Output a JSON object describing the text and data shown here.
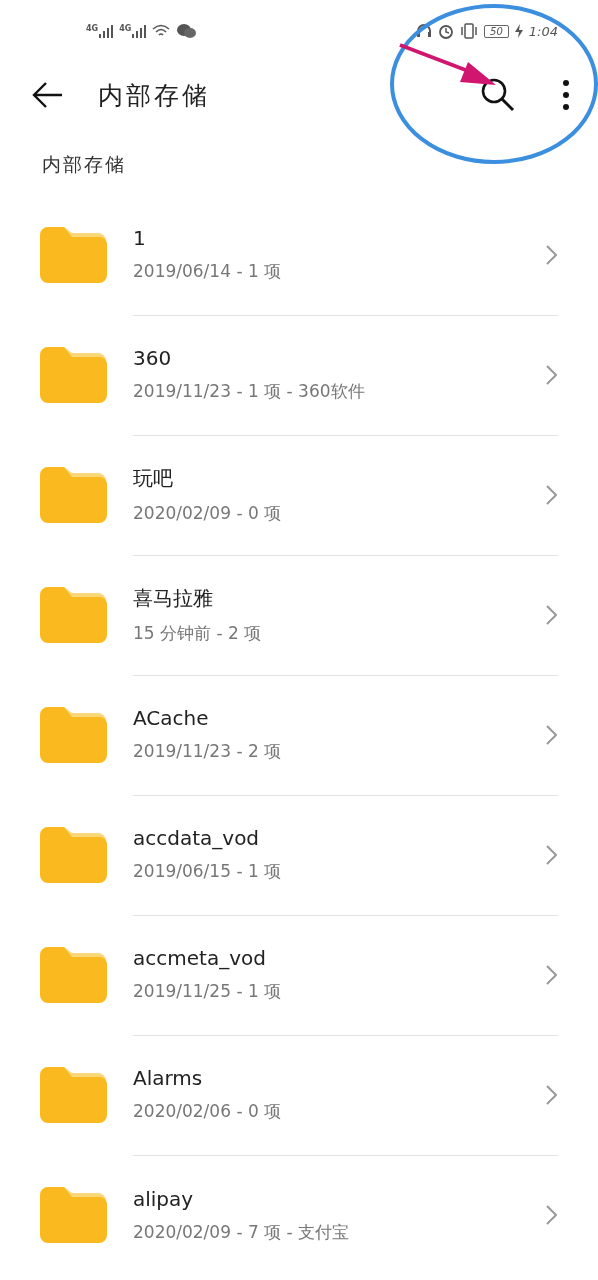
{
  "status_bar": {
    "signals": [
      "4G",
      "4G"
    ],
    "battery": "50",
    "time": "1:04"
  },
  "header": {
    "title": "内部存储"
  },
  "breadcrumb": "内部存储",
  "folders": [
    {
      "name": "1",
      "details": "2019/06/14 - 1 项"
    },
    {
      "name": "360",
      "details": "2019/11/23 - 1 项 - 360软件"
    },
    {
      "name": "玩吧",
      "details": "2020/02/09 - 0 项"
    },
    {
      "name": "喜马拉雅",
      "details": "15 分钟前 - 2 项"
    },
    {
      "name": "ACache",
      "details": "2019/11/23 - 2 项"
    },
    {
      "name": "accdata_vod",
      "details": "2019/06/15 - 1 项"
    },
    {
      "name": "accmeta_vod",
      "details": "2019/11/25 - 1 项"
    },
    {
      "name": "Alarms",
      "details": "2020/02/06 - 0 项"
    },
    {
      "name": "alipay",
      "details": "2020/02/09 - 7 项 - 支付宝"
    }
  ],
  "annotations": [
    {
      "kind": "ellipse"
    },
    {
      "kind": "arrow"
    }
  ]
}
